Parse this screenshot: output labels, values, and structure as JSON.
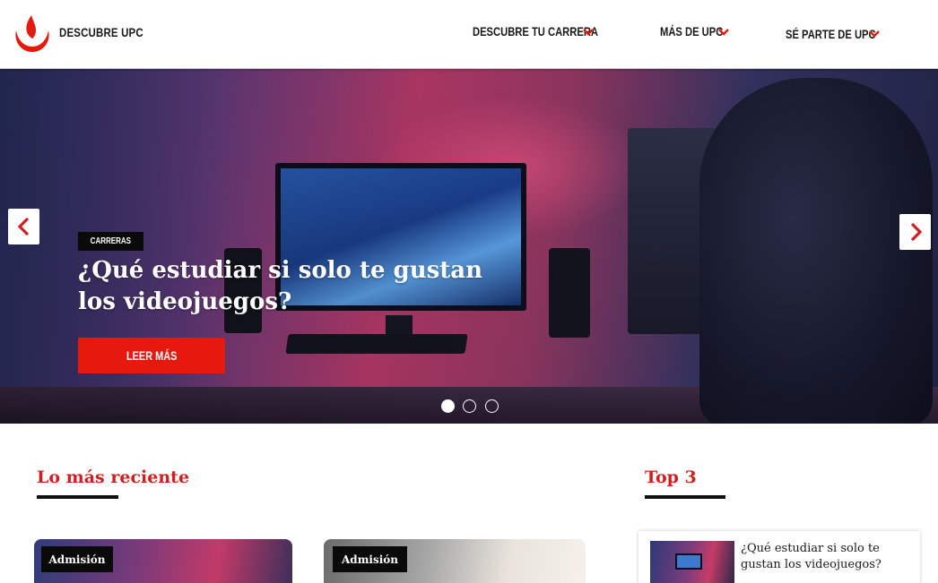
{
  "header": {
    "brand": "DESCUBRE UPC",
    "nav": [
      {
        "label": "DESCUBRE TU CARRERA"
      },
      {
        "label": "MÁS DE UPC"
      },
      {
        "label": "SÉ PARTE DE UPC"
      }
    ]
  },
  "hero": {
    "tag": "CARRERAS",
    "title": "¿Qué estudiar si solo te gustan los videojuegos?",
    "cta": "LEER MÁS",
    "slide_count": 3,
    "active_slide": 1
  },
  "recent": {
    "title": "Lo más reciente",
    "cards": [
      {
        "tag": "Admisión"
      },
      {
        "tag": "Admisión"
      }
    ]
  },
  "top3": {
    "title": "Top 3",
    "items": [
      {
        "title": "¿Qué estudiar si solo te gustan los videojuegos?"
      }
    ]
  },
  "colors": {
    "brand_red": "#e5190e",
    "heading_red": "#d11f1f",
    "text_dark": "#1a1a1a"
  },
  "icons": [
    "upc-logo-icon",
    "chevron-down-icon",
    "chevron-left-icon",
    "chevron-right-icon"
  ]
}
